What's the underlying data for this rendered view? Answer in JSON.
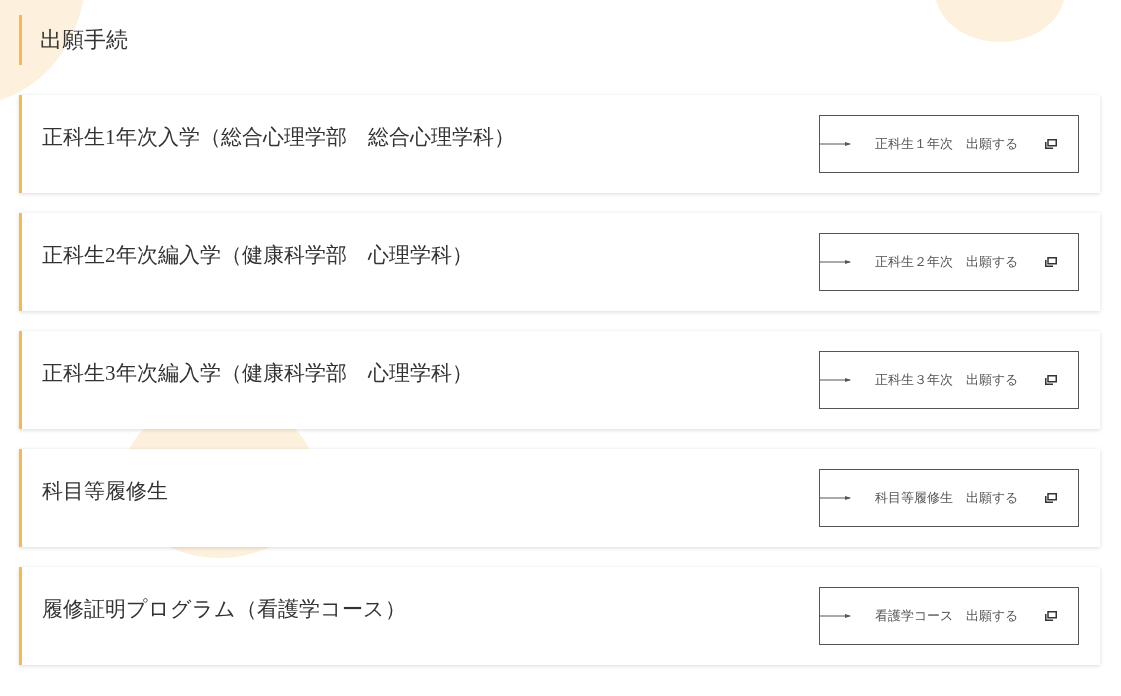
{
  "heading": "出願手続",
  "items": [
    {
      "title": "正科生1年次入学（総合心理学部　総合心理学科）",
      "button": "正科生１年次　出願する"
    },
    {
      "title": "正科生2年次編入学（健康科学部　心理学科）",
      "button": "正科生２年次　出願する"
    },
    {
      "title": "正科生3年次編入学（健康科学部　心理学科）",
      "button": "正科生３年次　出願する"
    },
    {
      "title": "科目等履修生",
      "button": "科目等履修生　出願する"
    },
    {
      "title": "履修証明プログラム（看護学コース）",
      "button": "看護学コース　出願する"
    }
  ]
}
